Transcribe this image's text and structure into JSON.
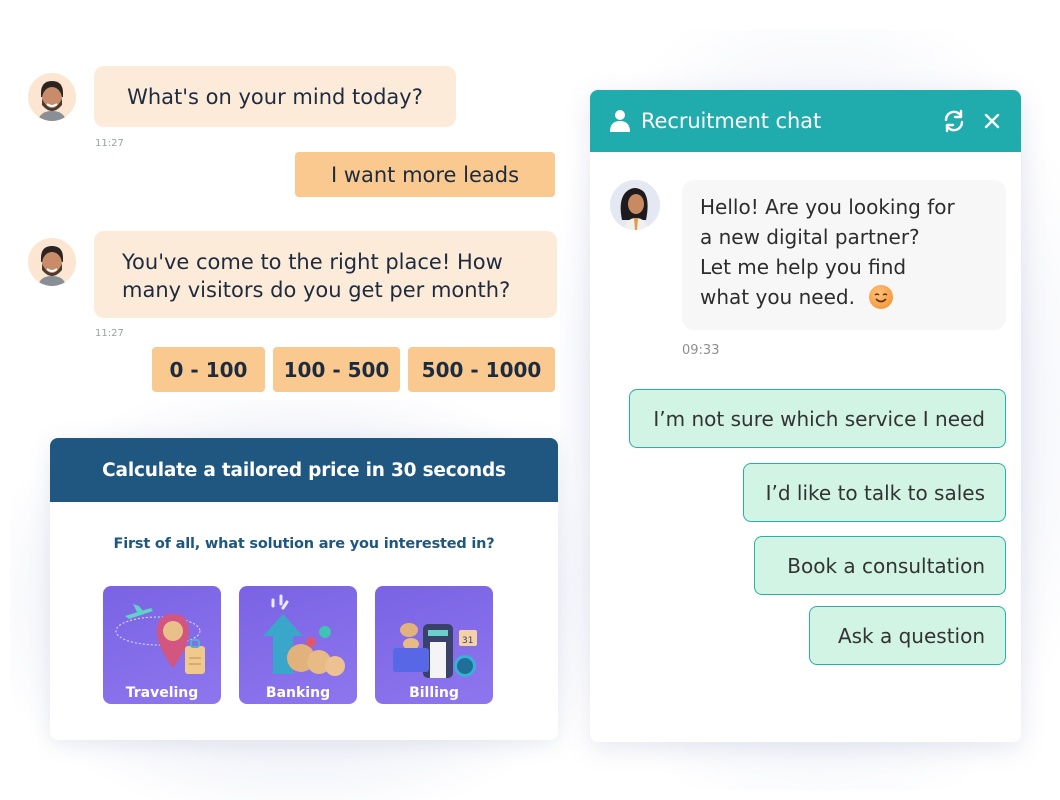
{
  "left_chat": {
    "messages": [
      {
        "sender": "bot",
        "text": "What's on your mind today?",
        "time": "11:27"
      },
      {
        "sender": "user",
        "text": "I want more leads"
      },
      {
        "sender": "bot",
        "lines": [
          "You've come to the right place! How",
          "many visitors do you get per month?"
        ],
        "time": "11:27"
      }
    ],
    "quick_replies": [
      "0 - 100",
      "100 - 500",
      "500 - 1000"
    ]
  },
  "calculator": {
    "title": "Calculate a tailored price in 30 seconds",
    "question": "First of all, what solution are you interested in?",
    "options": [
      {
        "label": "Traveling",
        "icon": "travel-illustration"
      },
      {
        "label": "Banking",
        "icon": "banking-illustration"
      },
      {
        "label": "Billing",
        "icon": "billing-illustration"
      }
    ]
  },
  "widget": {
    "title": "Recruitment chat",
    "icons": {
      "header": "person-icon",
      "refresh": "refresh-icon",
      "close": "close-icon"
    },
    "agent_message": {
      "lines": [
        "Hello! Are you looking for",
        "a new digital partner?",
        "Let me help you find",
        "what you need."
      ],
      "emoji": "smiling-face",
      "time": "09:33"
    },
    "options": [
      "I’m not sure which service I need",
      "I’d like to talk to sales",
      "Book a consultation",
      "Ask a question"
    ]
  },
  "colors": {
    "bot_bubble": "#fdebd9",
    "user_pill": "#f9c98f",
    "calc_header": "#1f5780",
    "tile_purple": "#7a63e4",
    "widget_header": "#20abad",
    "option_fill": "#d1f4e4",
    "option_border": "#28aeaa"
  }
}
